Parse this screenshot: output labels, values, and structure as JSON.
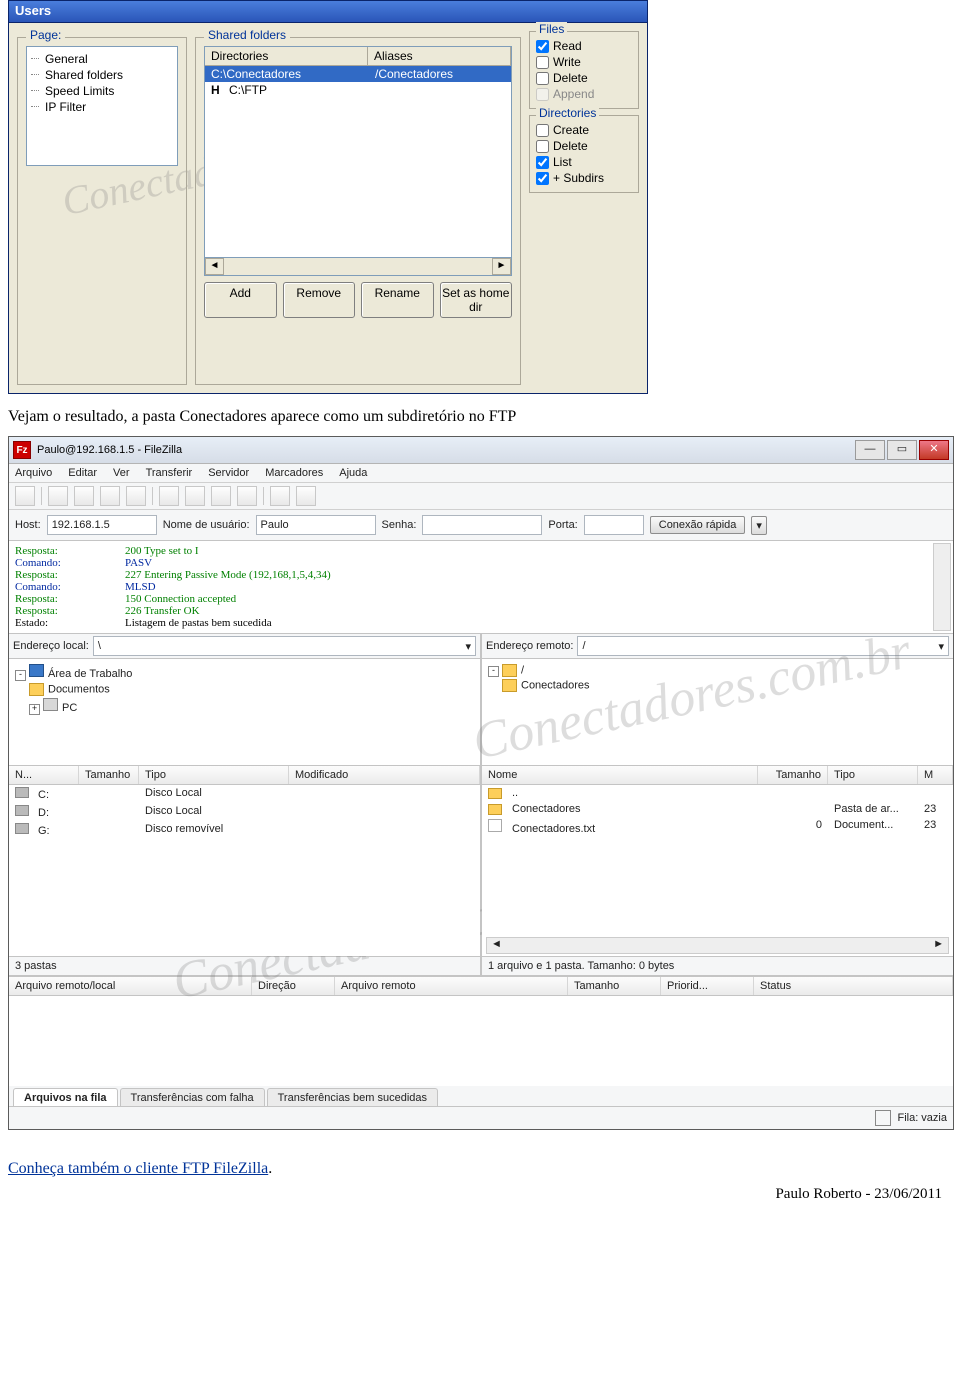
{
  "shot1": {
    "title": "Users",
    "page_group": "Page:",
    "tree": [
      "General",
      "Shared folders",
      "Speed Limits",
      "IP Filter"
    ],
    "shared_group": "Shared folders",
    "dirlist": {
      "hdr": [
        "Directories",
        "Aliases"
      ],
      "rows": [
        {
          "dir": "C:\\Conectadores",
          "alias": "/Conectadores",
          "sel": true,
          "home": false
        },
        {
          "dir": "C:\\FTP",
          "alias": "",
          "sel": false,
          "home": true
        }
      ]
    },
    "buttons": [
      "Add",
      "Remove",
      "Rename",
      "Set as home dir"
    ],
    "files": {
      "legend": "Files",
      "items": [
        {
          "label": "Read",
          "checked": true
        },
        {
          "label": "Write",
          "checked": false
        },
        {
          "label": "Delete",
          "checked": false
        },
        {
          "label": "Append",
          "checked": false,
          "disabled": true
        }
      ]
    },
    "dirs": {
      "legend": "Directories",
      "items": [
        {
          "label": "Create",
          "checked": false
        },
        {
          "label": "Delete",
          "checked": false
        },
        {
          "label": "List",
          "checked": true
        },
        {
          "label": "+ Subdirs",
          "checked": true
        }
      ]
    }
  },
  "caption": "Vejam o resultado, a pasta Conectadores aparece como um subdiretório no FTP",
  "shot2": {
    "title": "Paulo@192.168.1.5 - FileZilla",
    "menu": [
      "Arquivo",
      "Editar",
      "Ver",
      "Transferir",
      "Servidor",
      "Marcadores",
      "Ajuda"
    ],
    "quick": {
      "host_lbl": "Host:",
      "host": "192.168.1.5",
      "user_lbl": "Nome de usuário:",
      "user": "Paulo",
      "pass_lbl": "Senha:",
      "pass": "",
      "port_lbl": "Porta:",
      "port": "",
      "btn": "Conexão rápida"
    },
    "log": [
      {
        "t": "Resposta:",
        "c": "res",
        "m": "200 Type set to I"
      },
      {
        "t": "Comando:",
        "c": "cmd",
        "m": "PASV"
      },
      {
        "t": "Resposta:",
        "c": "res",
        "m": "227 Entering Passive Mode (192,168,1,5,4,34)"
      },
      {
        "t": "Comando:",
        "c": "cmd",
        "m": "MLSD"
      },
      {
        "t": "Resposta:",
        "c": "res",
        "m": "150 Connection accepted"
      },
      {
        "t": "Resposta:",
        "c": "res",
        "m": "226 Transfer OK"
      },
      {
        "t": "Estado:",
        "c": "st",
        "m": "Listagem de pastas bem sucedida"
      }
    ],
    "local": {
      "addr_lbl": "Endereço local:",
      "addr": "\\",
      "tree": [
        {
          "lvl": 0,
          "exp": "-",
          "ico": "desktop",
          "label": "Área de Trabalho"
        },
        {
          "lvl": 1,
          "exp": "",
          "ico": "folder",
          "label": "Documentos"
        },
        {
          "lvl": 1,
          "exp": "+",
          "ico": "pc",
          "label": "PC"
        }
      ],
      "hdr": [
        "N...",
        "Tamanho",
        "Tipo",
        "Modificado"
      ],
      "rows": [
        {
          "n": "C:",
          "t": "Disco Local"
        },
        {
          "n": "D:",
          "t": "Disco Local"
        },
        {
          "n": "G:",
          "t": "Disco removível"
        }
      ],
      "status": "3 pastas"
    },
    "remote": {
      "addr_lbl": "Endereço remoto:",
      "addr": "/",
      "tree": [
        {
          "lvl": 0,
          "exp": "-",
          "label": "/"
        },
        {
          "lvl": 1,
          "exp": "",
          "label": "Conectadores"
        }
      ],
      "hdr": [
        "Nome",
        "Tamanho",
        "Tipo",
        "M"
      ],
      "rows": [
        {
          "n": "..",
          "s": "",
          "t": "",
          "m": ""
        },
        {
          "n": "Conectadores",
          "s": "",
          "t": "Pasta de ar...",
          "m": "23"
        },
        {
          "n": "Conectadores.txt",
          "s": "0",
          "t": "Document...",
          "m": "23"
        }
      ],
      "status": "1 arquivo e 1 pasta. Tamanho: 0 bytes"
    },
    "queue_hdr": [
      "Arquivo remoto/local",
      "Direção",
      "Arquivo remoto",
      "Tamanho",
      "Priorid...",
      "Status"
    ],
    "tabs": [
      "Arquivos na fila",
      "Transferências com falha",
      "Transferências bem sucedidas"
    ],
    "footer": "Fila: vazia"
  },
  "link": "Conheça também o cliente FTP FileZilla",
  "signature": "Paulo Roberto - 23/06/2011",
  "watermark": "Conectadores.com.br"
}
